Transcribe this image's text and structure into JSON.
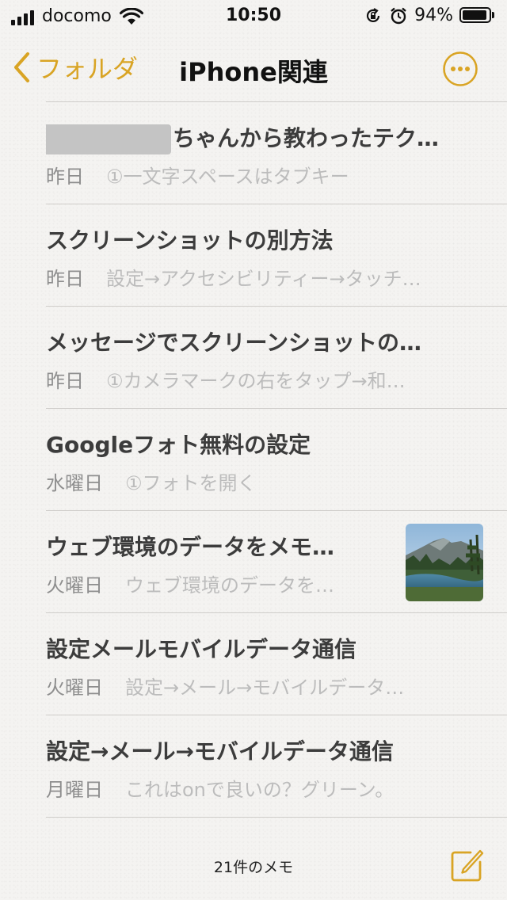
{
  "status_bar": {
    "carrier": "docomo",
    "time": "10:50",
    "battery": "94%",
    "battery_level": 0.94
  },
  "nav": {
    "back_label": "フォルダ",
    "title": "iPhone関連"
  },
  "notes": [
    {
      "title": "ちゃんから教わったテク…",
      "date": "昨日",
      "preview": "①一文字スペースはタブキー"
    },
    {
      "title": "スクリーンショットの別方法",
      "date": "昨日",
      "preview": "設定→アクセシビリティー→タッチ…"
    },
    {
      "title": "メッセージでスクリーンショットの…",
      "date": "昨日",
      "preview": "①カメラマークの右をタップ→和…"
    },
    {
      "title": "Googleフォト無料の設定",
      "date": "水曜日",
      "preview": "①フォトを開く"
    },
    {
      "title": "ウェブ環境のデータをメモ…",
      "date": "火曜日",
      "preview": "ウェブ環境のデータを…"
    },
    {
      "title": "設定メールモバイルデータ通信",
      "date": "火曜日",
      "preview": "設定→メール→モバイルデータ…"
    },
    {
      "title": "設定→メール→モバイルデータ通信",
      "date": "月曜日",
      "preview": "これはonで良いの？グリーン。"
    }
  ],
  "footer": {
    "count_label": "21件のメモ"
  },
  "colors": {
    "accent": "#d9a424",
    "title_text": "#3c3c3c",
    "date_text": "#8e8e8e",
    "preview_text": "#bcbcbc"
  }
}
